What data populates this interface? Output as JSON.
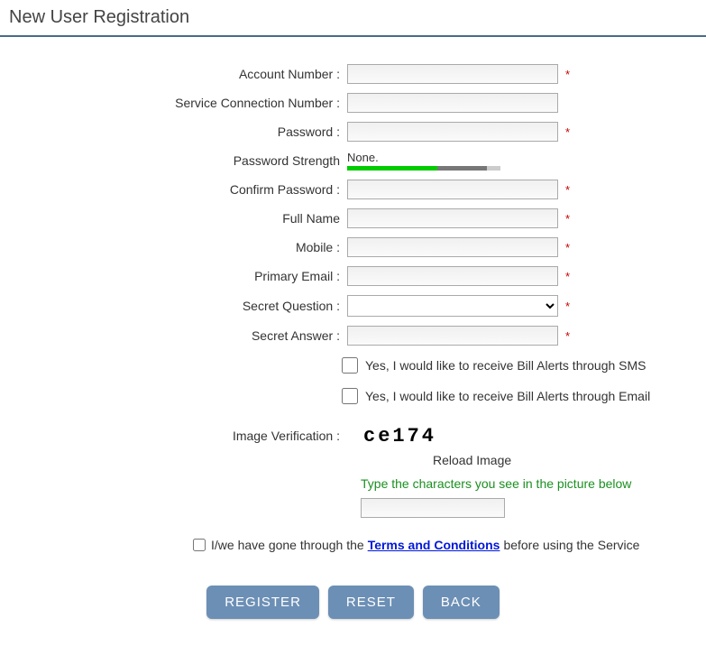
{
  "page": {
    "title": "New User Registration"
  },
  "labels": {
    "account_number": "Account Number :",
    "service_connection": "Service Connection Number :",
    "password": "Password :",
    "password_strength": "Password Strength",
    "confirm_password": "Confirm Password :",
    "full_name": "Full Name",
    "mobile": "Mobile :",
    "primary_email": "Primary Email :",
    "secret_question": "Secret Question :",
    "secret_answer": "Secret Answer :",
    "image_verification": "Image Verification :",
    "required_mark": "*"
  },
  "values": {
    "account_number": "",
    "service_connection": "",
    "password": "",
    "strength_text": "None.",
    "confirm_password": "",
    "full_name": "",
    "mobile": "",
    "primary_email": "",
    "secret_question_selected": "",
    "secret_answer": "",
    "captcha_text": "ce174",
    "captcha_input": ""
  },
  "checkboxes": {
    "sms_alerts": "Yes, I would like to receive Bill Alerts through SMS",
    "email_alerts": "Yes, I would like to receive Bill Alerts through Email",
    "terms_prefix": "I/we have gone through the",
    "terms_link": "Terms and Conditions",
    "terms_suffix": "before using the Service"
  },
  "captcha": {
    "reload": "Reload Image",
    "hint": "Type the characters you see in the picture below"
  },
  "buttons": {
    "register": "REGISTER",
    "reset": "RESET",
    "back": "BACK"
  }
}
